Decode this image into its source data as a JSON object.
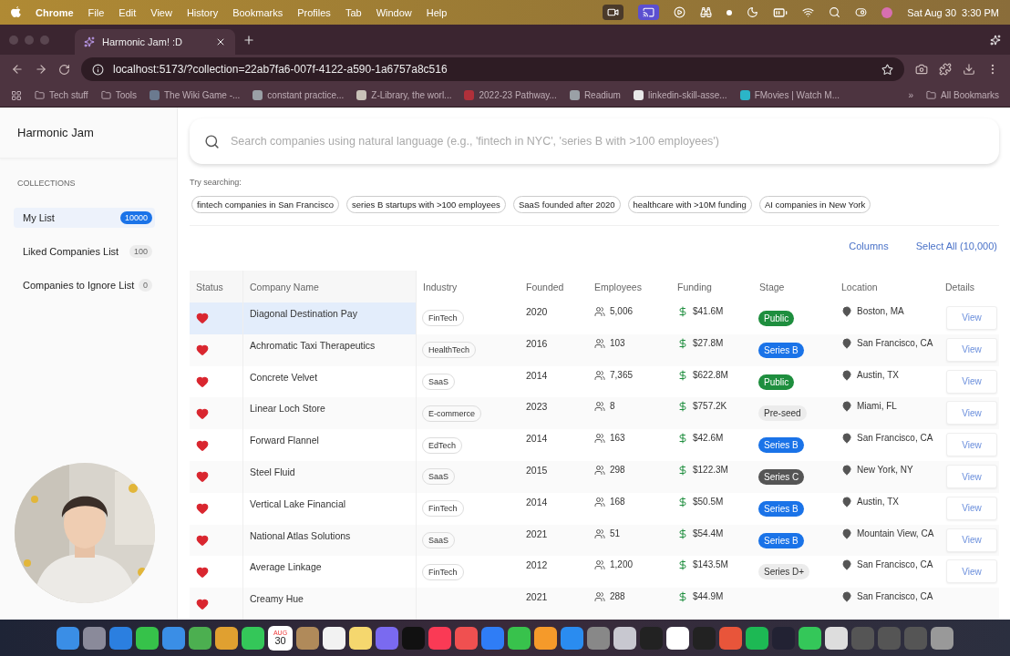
{
  "menubar": {
    "app": "Chrome",
    "menus": [
      "File",
      "Edit",
      "View",
      "History",
      "Bookmarks",
      "Profiles",
      "Tab",
      "Window",
      "Help"
    ],
    "date": "Sat Aug 30",
    "time": "3:30 PM"
  },
  "browser": {
    "tab_title": "Harmonic Jam! :D",
    "url": "localhost:5173/?collection=22ab7fa6-007f-4122-a590-1a6757a8c516",
    "bookmarks": [
      {
        "label": "Tech stuff",
        "kind": "folder"
      },
      {
        "label": "Tools",
        "kind": "folder"
      },
      {
        "label": "The Wiki Game -...",
        "kind": "site",
        "color": "#6b7a8f"
      },
      {
        "label": "constant practice...",
        "kind": "site",
        "color": "#9aa0a6"
      },
      {
        "label": "Z-Library, the worl...",
        "kind": "site",
        "color": "#c9c2b8"
      },
      {
        "label": "2022-23 Pathway...",
        "kind": "site",
        "color": "#b0303a"
      },
      {
        "label": "Readium",
        "kind": "site",
        "color": "#9aa0a6"
      },
      {
        "label": "linkedin-skill-asse...",
        "kind": "site",
        "color": "#e8e8e8"
      },
      {
        "label": "FMovies | Watch M...",
        "kind": "site",
        "color": "#2bb5c8"
      }
    ],
    "overflow": "»",
    "all_bookmarks": "All Bookmarks"
  },
  "sidebar": {
    "title": "Harmonic Jam",
    "section": "COLLECTIONS",
    "items": [
      {
        "label": "My List",
        "count": "10000",
        "selected": true
      },
      {
        "label": "Liked Companies List",
        "count": "100",
        "selected": false
      },
      {
        "label": "Companies to Ignore List",
        "count": "0",
        "selected": false
      }
    ]
  },
  "search": {
    "placeholder": "Search companies using natural language (e.g., 'fintech in NYC', 'series B with >100 employees')",
    "hint": "Try searching:",
    "suggestions": [
      "fintech companies in San Francisco",
      "series B startups with >100 employees",
      "SaaS founded after 2020",
      "healthcare with >10M funding",
      "AI companies in New York"
    ]
  },
  "toolbar": {
    "columns": "Columns",
    "select_all": "Select All (10,000)"
  },
  "table": {
    "columns": [
      "Status",
      "Company Name",
      "Industry",
      "Founded",
      "Employees",
      "Funding",
      "Stage",
      "Location",
      "Details"
    ],
    "rows": [
      {
        "liked": true,
        "selected": true,
        "name": "Diagonal Destination Pay",
        "industry": "FinTech",
        "founded": "2020",
        "employees": "5,006",
        "funding": "$41.6M",
        "stage": {
          "label": "Public",
          "color": "#1e8e3e"
        },
        "location": "Boston, MA",
        "details": "View"
      },
      {
        "liked": true,
        "selected": false,
        "name": "Achromatic Taxi Therapeutics",
        "industry": "HealthTech",
        "founded": "2016",
        "employees": "103",
        "funding": "$27.8M",
        "stage": {
          "label": "Series B",
          "color": "#1a73e8"
        },
        "location": "San Francisco, CA",
        "details": "View"
      },
      {
        "liked": true,
        "selected": false,
        "name": "Concrete Velvet",
        "industry": "SaaS",
        "founded": "2014",
        "employees": "7,365",
        "funding": "$622.8M",
        "stage": {
          "label": "Public",
          "color": "#1e8e3e"
        },
        "location": "Austin, TX",
        "details": "View"
      },
      {
        "liked": true,
        "selected": false,
        "name": "Linear Loch Store",
        "industry": "E-commerce",
        "founded": "2023",
        "employees": "8",
        "funding": "$757.2K",
        "stage": {
          "label": "Pre-seed",
          "color": "#ececec"
        },
        "location": "Miami, FL",
        "details": "View"
      },
      {
        "liked": true,
        "selected": false,
        "name": "Forward Flannel",
        "industry": "EdTech",
        "founded": "2014",
        "employees": "163",
        "funding": "$42.6M",
        "stage": {
          "label": "Series B",
          "color": "#1a73e8"
        },
        "location": "San Francisco, CA",
        "details": "View"
      },
      {
        "liked": true,
        "selected": false,
        "name": "Steel Fluid",
        "industry": "SaaS",
        "founded": "2015",
        "employees": "298",
        "funding": "$122.3M",
        "stage": {
          "label": "Series C",
          "color": "#555555"
        },
        "location": "New York, NY",
        "details": "View"
      },
      {
        "liked": true,
        "selected": false,
        "name": "Vertical Lake Financial",
        "industry": "FinTech",
        "founded": "2014",
        "employees": "168",
        "funding": "$50.5M",
        "stage": {
          "label": "Series B",
          "color": "#1a73e8"
        },
        "location": "Austin, TX",
        "details": "View"
      },
      {
        "liked": true,
        "selected": false,
        "name": "National Atlas Solutions",
        "industry": "SaaS",
        "founded": "2021",
        "employees": "51",
        "funding": "$54.4M",
        "stage": {
          "label": "Series B",
          "color": "#1a73e8"
        },
        "location": "Mountain View, CA",
        "details": "View"
      },
      {
        "liked": true,
        "selected": false,
        "name": "Average Linkage",
        "industry": "FinTech",
        "founded": "2012",
        "employees": "1,200",
        "funding": "$143.5M",
        "stage": {
          "label": "Series D+",
          "color": "#ececec"
        },
        "location": "San Francisco, CA",
        "details": "View"
      },
      {
        "liked": true,
        "selected": false,
        "name": "Creamy Hue",
        "founded": "2021",
        "employees": "288",
        "funding": "$44.9M",
        "location": "San Francisco, CA"
      }
    ]
  },
  "dock": {
    "calendar_month": "AUG",
    "calendar_day": "30"
  }
}
